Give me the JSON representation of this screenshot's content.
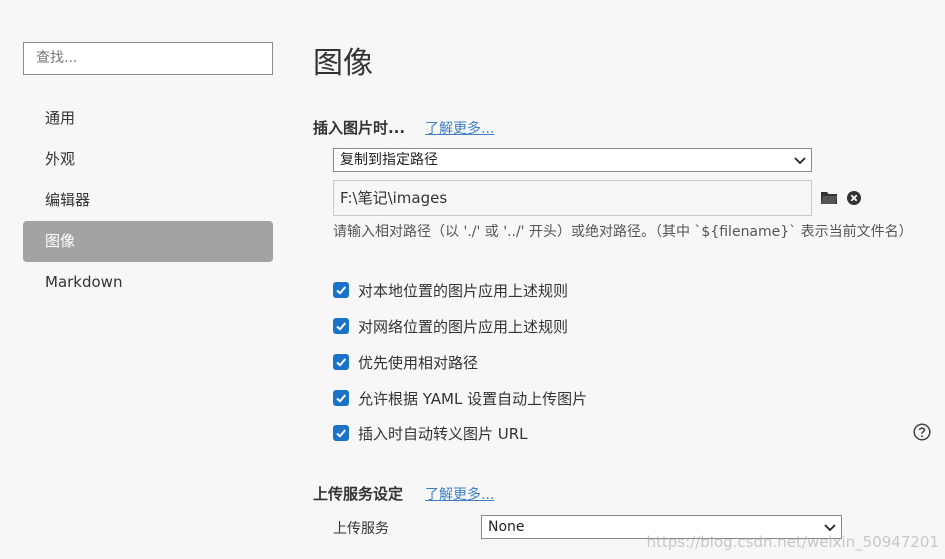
{
  "sidebar": {
    "search_placeholder": "查找...",
    "items": [
      {
        "label": "通用",
        "active": false
      },
      {
        "label": "外观",
        "active": false
      },
      {
        "label": "编辑器",
        "active": false
      },
      {
        "label": "图像",
        "active": true
      },
      {
        "label": "Markdown",
        "active": false
      }
    ]
  },
  "main": {
    "title": "图像",
    "insert_section": {
      "heading": "插入图片时...",
      "learn_more": "了解更多...",
      "action_select": "复制到指定路径",
      "path_value": "F:\\笔记\\images",
      "hint": "请输入相对路径（以 './' 或 '../' 开头）或绝对路径。（其中 `${filename}` 表示当前文件名）"
    },
    "checkboxes": [
      {
        "label": "对本地位置的图片应用上述规则",
        "checked": true
      },
      {
        "label": "对网络位置的图片应用上述规则",
        "checked": true
      },
      {
        "label": "优先使用相对路径",
        "checked": true
      },
      {
        "label": "允许根据 YAML 设置自动上传图片",
        "checked": true
      },
      {
        "label": "插入时自动转义图片 URL",
        "checked": true
      }
    ],
    "upload_section": {
      "heading": "上传服务设定",
      "learn_more": "了解更多...",
      "service_label": "上传服务",
      "service_value": "None"
    }
  },
  "watermark": "https://blog.csdn.net/weixin_50947201",
  "colors": {
    "accent": "#1a73c8",
    "link": "#3f7fc7",
    "active_nav": "#a3a3a3"
  }
}
